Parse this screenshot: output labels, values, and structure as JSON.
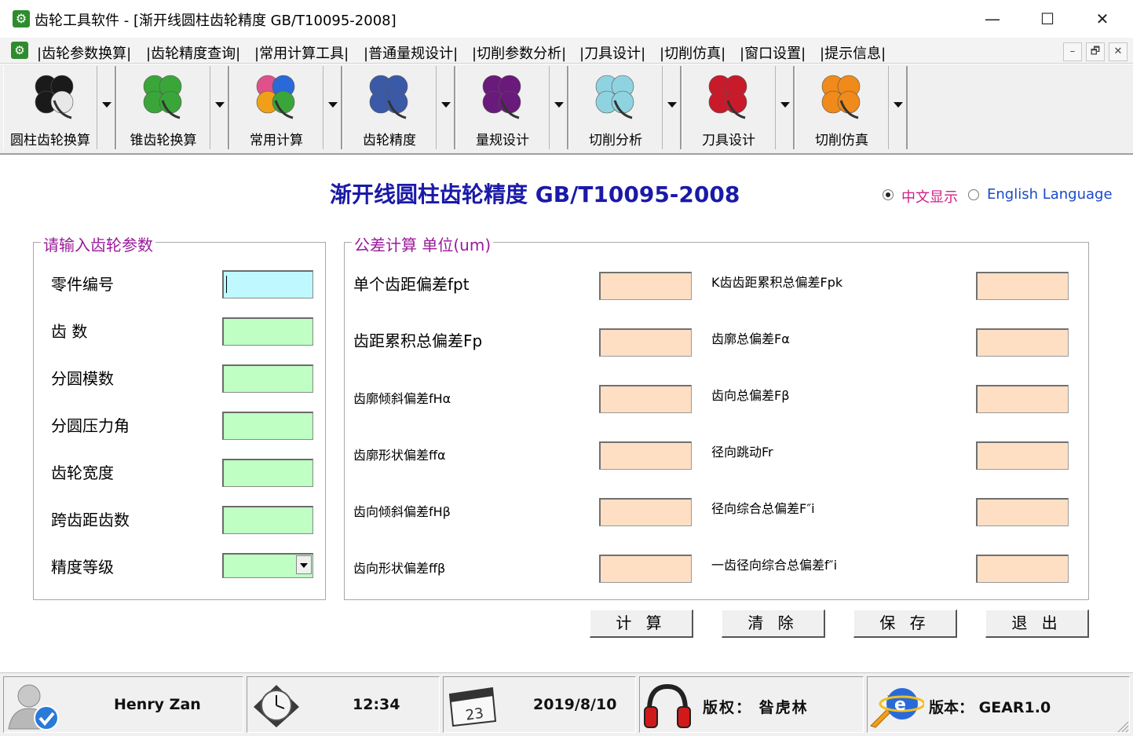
{
  "window": {
    "title": "齿轮工具软件 - [渐开线圆柱齿轮精度 GB/T10095-2008]",
    "minimize": "—",
    "maximize": "☐",
    "close": "✕"
  },
  "menu": {
    "items": [
      "|齿轮参数换算|",
      "|齿轮精度查询|",
      "|常用计算工具|",
      "|普通量规设计|",
      "|切削参数分析|",
      "|刀具设计|",
      "|切削仿真|",
      "|窗口设置|",
      "|提示信息|"
    ],
    "mdi": [
      "–",
      "🗗",
      "✕"
    ]
  },
  "toolbar": {
    "buttons": [
      {
        "label": "圆柱齿轮换算",
        "icon": "black-clover-icon",
        "color": "#1a1a1a"
      },
      {
        "label": "锥齿轮换算",
        "icon": "green-clover-icon",
        "color": "#3aa63a"
      },
      {
        "label": "常用计算",
        "icon": "colorful-clover-icon",
        "color": "#e0508a"
      },
      {
        "label": "齿轮精度",
        "icon": "blue-clover-icon",
        "color": "#3a5aa8"
      },
      {
        "label": "量规设计",
        "icon": "purple-clover-icon",
        "color": "#6a1a7a"
      },
      {
        "label": "切削分析",
        "icon": "cyan-clover-icon",
        "color": "#8fd3e0"
      },
      {
        "label": "刀具设计",
        "icon": "red-clover-icon",
        "color": "#c81a2a"
      },
      {
        "label": "切削仿真",
        "icon": "orange-rss-clover-icon",
        "color": "#f08a1a"
      }
    ]
  },
  "main": {
    "title": "渐开线圆柱齿轮精度 GB/T10095-2008",
    "lang_cn": "中文显示",
    "lang_en": "English Language"
  },
  "input_group": {
    "title": "请输入齿轮参数",
    "fields": [
      "零件编号",
      "齿  数",
      "分圆模数",
      "分圆压力角",
      "齿轮宽度",
      "跨齿距齿数",
      "精度等级"
    ]
  },
  "result_group": {
    "title": "公差计算 单位(um)",
    "left": [
      "单个齿距偏差fpt",
      "齿距累积总偏差Fp",
      "齿廓倾斜偏差fHα",
      "齿廓形状偏差ffα",
      "齿向倾斜偏差fHβ",
      "齿向形状偏差ffβ"
    ],
    "right": [
      "K齿齿距累积总偏差Fpk",
      "齿廓总偏差Fα",
      "齿向总偏差Fβ",
      "径向跳动Fr",
      "径向综合总偏差F″i",
      "一齿径向综合总偏差f″i"
    ]
  },
  "actions": {
    "calc": "计 算",
    "clear": "清 除",
    "save": "保 存",
    "exit": "退 出"
  },
  "status": {
    "user": "Henry Zan",
    "time": "12:34",
    "date": "2019/8/10",
    "calendar_day": "23",
    "copyright": "版权： 昝虎林",
    "version": "版本：  GEAR1.0"
  },
  "colors": {
    "title_blue": "#1a1aa8",
    "group_purple": "#9b1a9b",
    "input_green": "#bfffc3",
    "input_cyan": "#bff8ff",
    "output_peach": "#ffdfc4"
  }
}
